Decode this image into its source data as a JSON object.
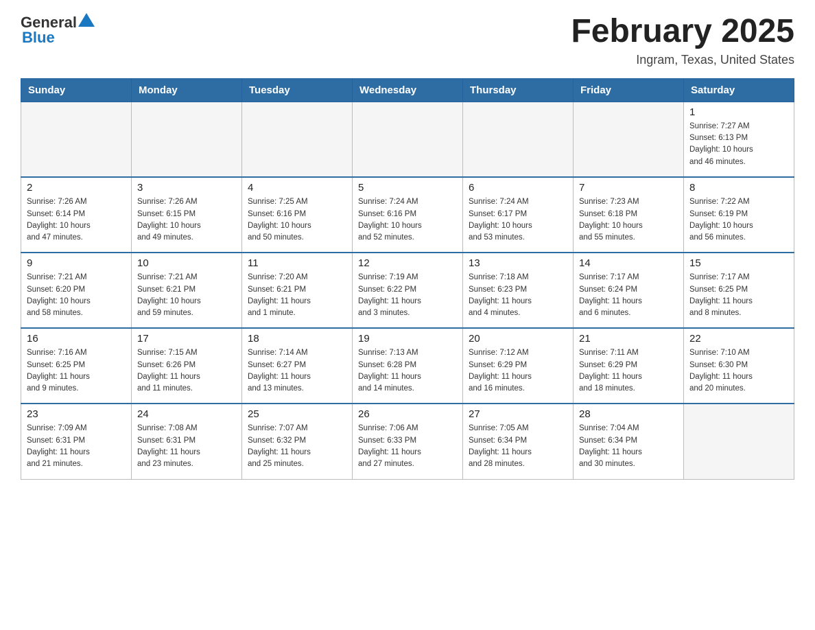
{
  "header": {
    "logo": {
      "general": "General",
      "blue": "Blue"
    },
    "title": "February 2025",
    "subtitle": "Ingram, Texas, United States"
  },
  "days_of_week": [
    "Sunday",
    "Monday",
    "Tuesday",
    "Wednesday",
    "Thursday",
    "Friday",
    "Saturday"
  ],
  "weeks": [
    [
      {
        "day": "",
        "info": ""
      },
      {
        "day": "",
        "info": ""
      },
      {
        "day": "",
        "info": ""
      },
      {
        "day": "",
        "info": ""
      },
      {
        "day": "",
        "info": ""
      },
      {
        "day": "",
        "info": ""
      },
      {
        "day": "1",
        "info": "Sunrise: 7:27 AM\nSunset: 6:13 PM\nDaylight: 10 hours\nand 46 minutes."
      }
    ],
    [
      {
        "day": "2",
        "info": "Sunrise: 7:26 AM\nSunset: 6:14 PM\nDaylight: 10 hours\nand 47 minutes."
      },
      {
        "day": "3",
        "info": "Sunrise: 7:26 AM\nSunset: 6:15 PM\nDaylight: 10 hours\nand 49 minutes."
      },
      {
        "day": "4",
        "info": "Sunrise: 7:25 AM\nSunset: 6:16 PM\nDaylight: 10 hours\nand 50 minutes."
      },
      {
        "day": "5",
        "info": "Sunrise: 7:24 AM\nSunset: 6:16 PM\nDaylight: 10 hours\nand 52 minutes."
      },
      {
        "day": "6",
        "info": "Sunrise: 7:24 AM\nSunset: 6:17 PM\nDaylight: 10 hours\nand 53 minutes."
      },
      {
        "day": "7",
        "info": "Sunrise: 7:23 AM\nSunset: 6:18 PM\nDaylight: 10 hours\nand 55 minutes."
      },
      {
        "day": "8",
        "info": "Sunrise: 7:22 AM\nSunset: 6:19 PM\nDaylight: 10 hours\nand 56 minutes."
      }
    ],
    [
      {
        "day": "9",
        "info": "Sunrise: 7:21 AM\nSunset: 6:20 PM\nDaylight: 10 hours\nand 58 minutes."
      },
      {
        "day": "10",
        "info": "Sunrise: 7:21 AM\nSunset: 6:21 PM\nDaylight: 10 hours\nand 59 minutes."
      },
      {
        "day": "11",
        "info": "Sunrise: 7:20 AM\nSunset: 6:21 PM\nDaylight: 11 hours\nand 1 minute."
      },
      {
        "day": "12",
        "info": "Sunrise: 7:19 AM\nSunset: 6:22 PM\nDaylight: 11 hours\nand 3 minutes."
      },
      {
        "day": "13",
        "info": "Sunrise: 7:18 AM\nSunset: 6:23 PM\nDaylight: 11 hours\nand 4 minutes."
      },
      {
        "day": "14",
        "info": "Sunrise: 7:17 AM\nSunset: 6:24 PM\nDaylight: 11 hours\nand 6 minutes."
      },
      {
        "day": "15",
        "info": "Sunrise: 7:17 AM\nSunset: 6:25 PM\nDaylight: 11 hours\nand 8 minutes."
      }
    ],
    [
      {
        "day": "16",
        "info": "Sunrise: 7:16 AM\nSunset: 6:25 PM\nDaylight: 11 hours\nand 9 minutes."
      },
      {
        "day": "17",
        "info": "Sunrise: 7:15 AM\nSunset: 6:26 PM\nDaylight: 11 hours\nand 11 minutes."
      },
      {
        "day": "18",
        "info": "Sunrise: 7:14 AM\nSunset: 6:27 PM\nDaylight: 11 hours\nand 13 minutes."
      },
      {
        "day": "19",
        "info": "Sunrise: 7:13 AM\nSunset: 6:28 PM\nDaylight: 11 hours\nand 14 minutes."
      },
      {
        "day": "20",
        "info": "Sunrise: 7:12 AM\nSunset: 6:29 PM\nDaylight: 11 hours\nand 16 minutes."
      },
      {
        "day": "21",
        "info": "Sunrise: 7:11 AM\nSunset: 6:29 PM\nDaylight: 11 hours\nand 18 minutes."
      },
      {
        "day": "22",
        "info": "Sunrise: 7:10 AM\nSunset: 6:30 PM\nDaylight: 11 hours\nand 20 minutes."
      }
    ],
    [
      {
        "day": "23",
        "info": "Sunrise: 7:09 AM\nSunset: 6:31 PM\nDaylight: 11 hours\nand 21 minutes."
      },
      {
        "day": "24",
        "info": "Sunrise: 7:08 AM\nSunset: 6:31 PM\nDaylight: 11 hours\nand 23 minutes."
      },
      {
        "day": "25",
        "info": "Sunrise: 7:07 AM\nSunset: 6:32 PM\nDaylight: 11 hours\nand 25 minutes."
      },
      {
        "day": "26",
        "info": "Sunrise: 7:06 AM\nSunset: 6:33 PM\nDaylight: 11 hours\nand 27 minutes."
      },
      {
        "day": "27",
        "info": "Sunrise: 7:05 AM\nSunset: 6:34 PM\nDaylight: 11 hours\nand 28 minutes."
      },
      {
        "day": "28",
        "info": "Sunrise: 7:04 AM\nSunset: 6:34 PM\nDaylight: 11 hours\nand 30 minutes."
      },
      {
        "day": "",
        "info": ""
      }
    ]
  ]
}
